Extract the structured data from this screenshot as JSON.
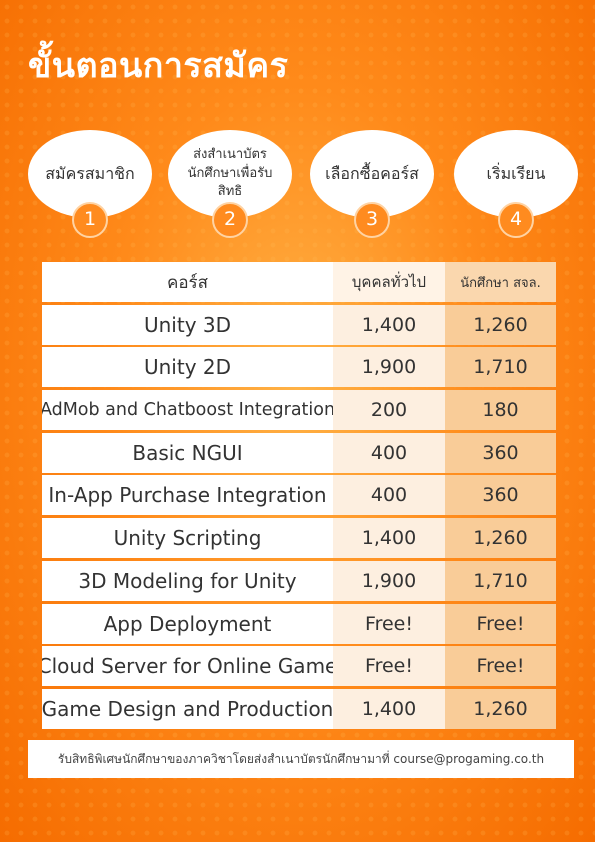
{
  "title": "ขั้นตอนการสมัคร",
  "steps": [
    {
      "label": "สมัครสมาชิก",
      "number": "1"
    },
    {
      "label": "ส่งสำเนาบัตรนักศึกษาเพื่อรับสิทธิ",
      "number": "2"
    },
    {
      "label": "เลือกซื้อคอร์ส",
      "number": "3"
    },
    {
      "label": "เริ่มเรียน",
      "number": "4"
    }
  ],
  "table": {
    "headers": [
      "คอร์ส",
      "บุคคลทั่วไป",
      "นักศึกษา สจล."
    ],
    "rows": [
      {
        "course": "Unity 3D",
        "general": "1,400",
        "student": "1,260"
      },
      {
        "course": "Unity 2D",
        "general": "1,900",
        "student": "1,710"
      },
      {
        "course": "AdMob and Chatboost Integration",
        "general": "200",
        "student": "180"
      },
      {
        "course": "Basic NGUI",
        "general": "400",
        "student": "360"
      },
      {
        "course": "In-App Purchase Integration",
        "general": "400",
        "student": "360"
      },
      {
        "course": "Unity Scripting",
        "general": "1,400",
        "student": "1,260"
      },
      {
        "course": "3D Modeling for Unity",
        "general": "1,900",
        "student": "1,710"
      },
      {
        "course": "App Deployment",
        "general": "Free!",
        "student": "Free!"
      },
      {
        "course": "Cloud Server for Online Game",
        "general": "Free!",
        "student": "Free!"
      },
      {
        "course": "Game Design and Production",
        "general": "1,400",
        "student": "1,260"
      }
    ]
  },
  "note": "รับสิทธิพิเศษนักศึกษาของภาควิชาโดยส่งสำเนาบัตรนักศึกษามาที่ course@progaming.co.th",
  "colors": {
    "background": "#ff8a1a",
    "student_column": "#f9cc98",
    "general_column": "#fdefe0"
  }
}
